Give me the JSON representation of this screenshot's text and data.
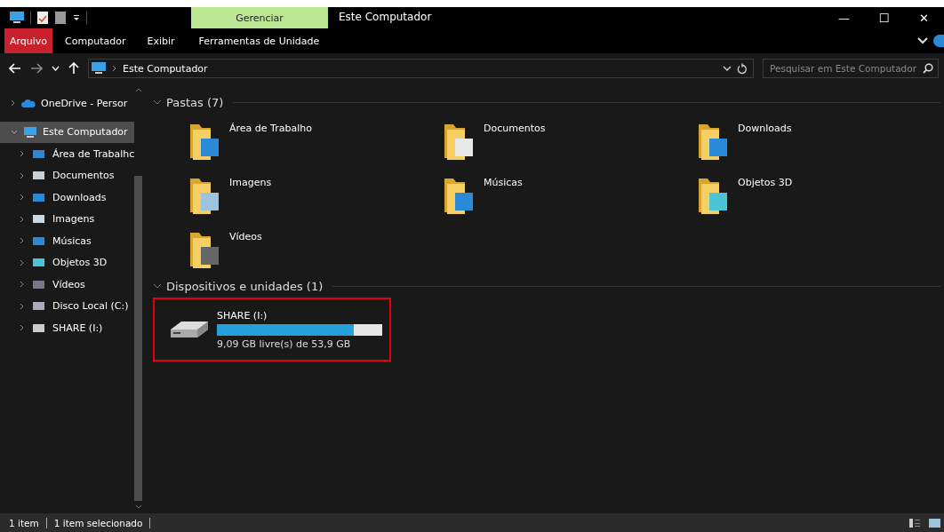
{
  "window": {
    "title": "Este Computador",
    "context_tab": "Gerenciar",
    "minimize": "—",
    "maximize": "☐",
    "close": "✕"
  },
  "ribbon": {
    "tabs": [
      {
        "label": "Arquivo",
        "kind": "file",
        "selected": false
      },
      {
        "label": "Computador",
        "kind": "tab",
        "selected": false
      },
      {
        "label": "Exibir",
        "kind": "tab",
        "selected": false
      },
      {
        "label": "Ferramentas de Unidade",
        "kind": "tab",
        "selected": false
      }
    ]
  },
  "address": {
    "path": "Este Computador",
    "search_placeholder": "Pesquisar em Este Computador"
  },
  "sidebar": {
    "items": [
      {
        "label": "OneDrive - Persor",
        "expanded": false,
        "selected": false
      },
      {
        "label": "Este Computador",
        "expanded": true,
        "selected": true,
        "children": [
          {
            "label": "Área de Trabalhc"
          },
          {
            "label": "Documentos"
          },
          {
            "label": "Downloads"
          },
          {
            "label": "Imagens"
          },
          {
            "label": "Músicas"
          },
          {
            "label": "Objetos 3D"
          },
          {
            "label": "Vídeos"
          },
          {
            "label": "Disco Local (C:)"
          },
          {
            "label": "SHARE (I:)"
          }
        ]
      }
    ]
  },
  "folders_group": {
    "title": "Pastas (7)",
    "items": [
      {
        "label": "Área de Trabalho"
      },
      {
        "label": "Documentos"
      },
      {
        "label": "Downloads"
      },
      {
        "label": "Imagens"
      },
      {
        "label": "Músicas"
      },
      {
        "label": "Objetos 3D"
      },
      {
        "label": "Vídeos"
      }
    ]
  },
  "devices_group": {
    "title": "Dispositivos e unidades (1)",
    "items": [
      {
        "label": "SHARE (I:)",
        "level": 0.83,
        "free": "9,09 GB livre(s) de 53,9 GB",
        "selected": true
      }
    ]
  },
  "status_bar": {
    "count": "1 item",
    "selection": "1 item selecionado"
  }
}
